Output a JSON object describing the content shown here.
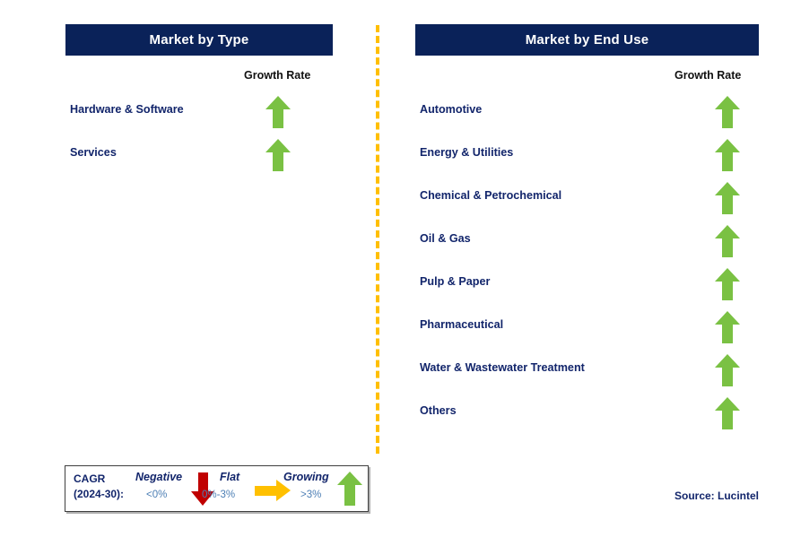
{
  "colors": {
    "header_bg": "#0a2259",
    "label_navy": "#12256b",
    "arrow_green": "#7ac143",
    "arrow_red": "#c00000",
    "arrow_amber": "#ffc000",
    "divider_amber": "#ffbf00",
    "range_blue": "#4d7fb5"
  },
  "columns": [
    {
      "id": "type",
      "title": "Market by Type",
      "growth_rate_label": "Growth Rate",
      "items": [
        {
          "label": "Hardware & Software",
          "trend": "growing",
          "icon": "arrow-up-icon"
        },
        {
          "label": "Services",
          "trend": "growing",
          "icon": "arrow-up-icon"
        }
      ]
    },
    {
      "id": "enduse",
      "title": "Market by End Use",
      "growth_rate_label": "Growth Rate",
      "items": [
        {
          "label": "Automotive",
          "trend": "growing",
          "icon": "arrow-up-icon"
        },
        {
          "label": "Energy & Utilities",
          "trend": "growing",
          "icon": "arrow-up-icon"
        },
        {
          "label": "Chemical & Petrochemical",
          "trend": "growing",
          "icon": "arrow-up-icon"
        },
        {
          "label": "Oil & Gas",
          "trend": "growing",
          "icon": "arrow-up-icon"
        },
        {
          "label": "Pulp & Paper",
          "trend": "growing",
          "icon": "arrow-up-icon"
        },
        {
          "label": "Pharmaceutical",
          "trend": "growing",
          "icon": "arrow-up-icon"
        },
        {
          "label": "Water & Wastewater Treatment",
          "trend": "growing",
          "icon": "arrow-up-icon"
        },
        {
          "label": "Others",
          "trend": "growing",
          "icon": "arrow-up-icon"
        }
      ]
    }
  ],
  "legend": {
    "title_line1": "CAGR",
    "title_line2": "(2024-30):",
    "items": [
      {
        "name": "Negative",
        "range": "<0%",
        "icon": "arrow-down-icon",
        "color": "#c00000"
      },
      {
        "name": "Flat",
        "range": "0%-3%",
        "icon": "arrow-right-icon",
        "color": "#ffc000"
      },
      {
        "name": "Growing",
        "range": ">3%",
        "icon": "arrow-up-icon",
        "color": "#7ac143"
      }
    ]
  },
  "source": "Source: Lucintel"
}
